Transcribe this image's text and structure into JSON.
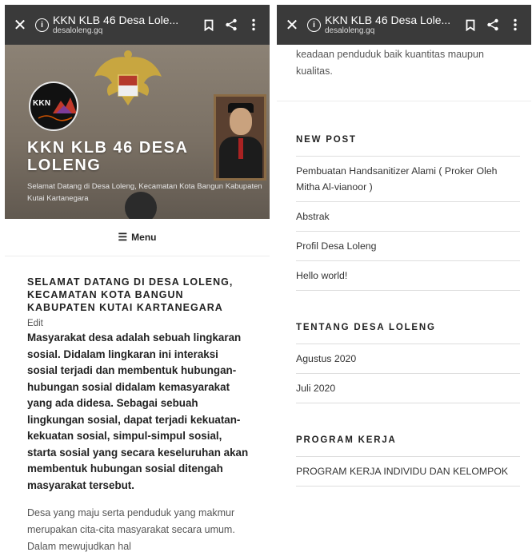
{
  "topbar": {
    "title": "KKN KLB 46 Desa Lole...",
    "url": "desaloleng.gq",
    "icons": [
      "close-icon",
      "info-icon",
      "bookmark-icon",
      "share-icon",
      "more-vert-icon"
    ]
  },
  "header": {
    "logo_text": "KKN",
    "site_title": "KKN KLB 46 DESA LOLENG",
    "site_description": "Selamat Datang di Desa Loleng, Kecamatan Kota Bangun Kabupaten Kutai Kartanegara"
  },
  "menu": {
    "label": "Menu"
  },
  "post": {
    "title": "SELAMAT DATANG DI DESA LOLENG, KECAMATAN KOTA BANGUN KABUPATEN KUTAI KARTANEGARA",
    "edit_label": "Edit",
    "lead": "Masyarakat desa adalah sebuah lingkaran sosial. Didalam lingkaran ini interaksi sosial terjadi dan membentuk hubungan-hubungan sosial didalam kemasyarakat yang ada didesa. Sebagai sebuah lingkungan sosial, dapat terjadi kekuatan-kekuatan sosial, simpul-simpul sosial, starta sosial yang secara keseluruhan akan membentuk hubungan sosial ditengah masyarakat tersebut.",
    "paragraph": "Desa yang maju serta penduduk yang makmur merupakan cita-cita masyarakat secara umum. Dalam mewujudkan hal"
  },
  "right_page": {
    "top_text": "keadaan penduduk baik kuantitas maupun kualitas.",
    "widgets": [
      {
        "title": "NEW POST",
        "items": [
          "Pembuatan Handsanitizer Alami ( Proker Oleh Mitha Al-vianoor )",
          "Abstrak",
          "Profil Desa Loleng",
          "Hello world!"
        ]
      },
      {
        "title": "TENTANG DESA LOLENG",
        "items": [
          "Agustus 2020",
          "Juli 2020"
        ]
      },
      {
        "title": "PROGRAM KERJA",
        "items": [
          "PROGRAM KERJA INDIVIDU DAN KELOMPOK"
        ]
      }
    ]
  },
  "colors": {
    "topbar": "#3a3a3a",
    "text": "#222222",
    "muted": "#555555"
  }
}
